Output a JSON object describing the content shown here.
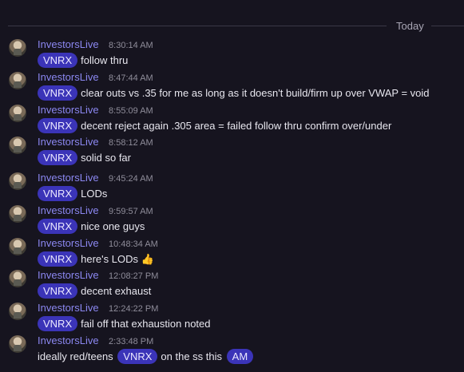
{
  "divider": {
    "label": "Today"
  },
  "messages": [
    {
      "user": "InvestorsLive",
      "time": "8:30:14 AM",
      "ticker": "VNRX",
      "text": "follow thru"
    },
    {
      "user": "InvestorsLive",
      "time": "8:47:44 AM",
      "ticker": "VNRX",
      "text": "clear outs vs .35 for me as long as it doesn't build/firm up over VWAP = void"
    },
    {
      "user": "InvestorsLive",
      "time": "8:55:09 AM",
      "ticker": "VNRX",
      "text": "decent reject again .305 area = failed follow thru confirm over/under"
    },
    {
      "user": "InvestorsLive",
      "time": "8:58:12 AM",
      "ticker": "VNRX",
      "text": "solid so far"
    },
    {
      "user": "InvestorsLive",
      "time": "9:45:24 AM",
      "ticker": "VNRX",
      "text": "LODs"
    },
    {
      "user": "InvestorsLive",
      "time": "9:59:57 AM",
      "ticker": "VNRX",
      "text": "nice one guys"
    },
    {
      "user": "InvestorsLive",
      "time": "10:48:34 AM",
      "ticker": "VNRX",
      "text": "here's LODs",
      "emoji": "👍"
    },
    {
      "user": "InvestorsLive",
      "time": "12:08:27 PM",
      "ticker": "VNRX",
      "text": "decent exhaust"
    },
    {
      "user": "InvestorsLive",
      "time": "12:24:22 PM",
      "ticker": "VNRX",
      "text": "fail off that exhaustion noted"
    },
    {
      "user": "InvestorsLive",
      "time": "2:33:48 PM",
      "pre": "ideally red/teens",
      "ticker": "VNRX",
      "mid": "on the ss this",
      "ticker2": "AM"
    }
  ]
}
